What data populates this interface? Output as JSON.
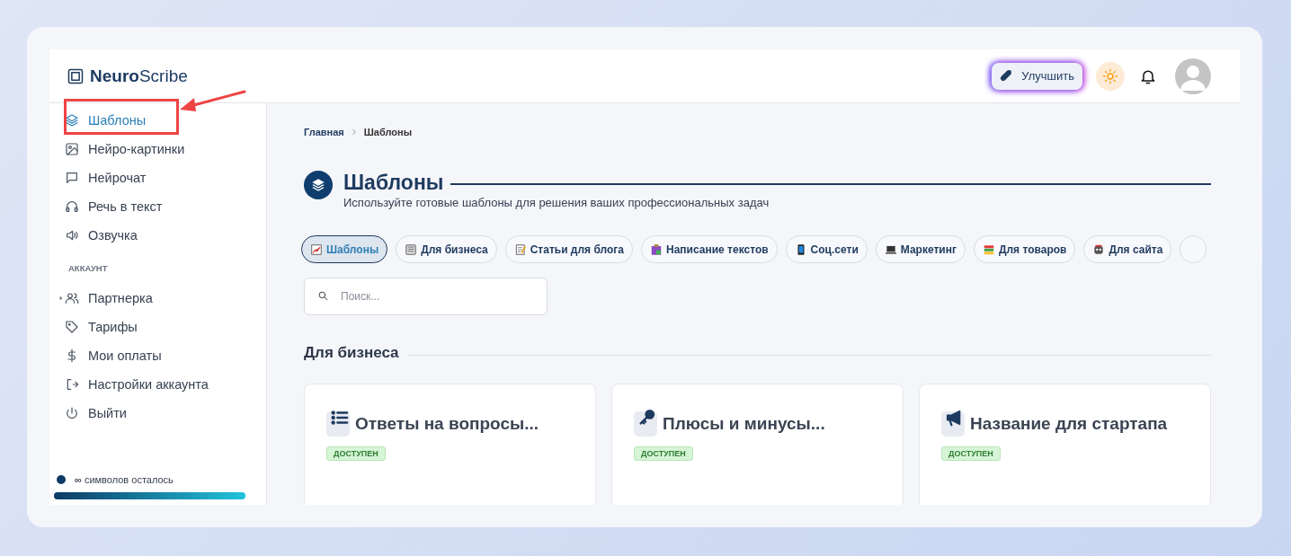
{
  "header": {
    "logo_bold": "Neuro",
    "logo_light": "Scribe",
    "upgrade_button": "Улучшить"
  },
  "sidebar": {
    "items": [
      {
        "label": "Шаблоны",
        "selected": true,
        "has_submenu": false
      },
      {
        "label": "Нейро-картинки",
        "selected": false,
        "has_submenu": false
      },
      {
        "label": "Нейрочат",
        "selected": false,
        "has_submenu": false
      },
      {
        "label": "Речь в текст",
        "selected": false,
        "has_submenu": false
      },
      {
        "label": "Озвучка",
        "selected": false,
        "has_submenu": false
      }
    ],
    "section_title": "АККАУНТ",
    "account_items": [
      {
        "label": "Партнерка",
        "selected": false,
        "has_submenu": true
      },
      {
        "label": "Тарифы",
        "selected": false,
        "has_submenu": false
      },
      {
        "label": "Мои оплаты",
        "selected": false,
        "has_submenu": false
      },
      {
        "label": "Настройки аккаунта",
        "selected": false,
        "has_submenu": false
      },
      {
        "label": "Выйти",
        "selected": false,
        "has_submenu": false
      }
    ],
    "usage": {
      "text": "**∞** символов осталось",
      "level": 1
    }
  },
  "breadcrumb": [
    "Главная",
    "Шаблоны"
  ],
  "page": {
    "title": "Шаблоны",
    "subtitle": "Используйте готовые шаблоны для решения ваших профессиональных задач"
  },
  "categories": [
    {
      "label": "Шаблоны",
      "selected": true
    },
    {
      "label": "Для бизнеса",
      "selected": false
    },
    {
      "label": "Статьи для блога",
      "selected": false
    },
    {
      "label": "Написание текстов",
      "selected": false
    },
    {
      "label": "Соц.сети",
      "selected": false
    },
    {
      "label": "Маркетинг",
      "selected": false
    },
    {
      "label": "Для товаров",
      "selected": false
    },
    {
      "label": "Для сайта",
      "selected": false
    }
  ],
  "search": {
    "placeholder": "Поиск..."
  },
  "section": {
    "title": "Для бизнеса",
    "cards": [
      {
        "title": "Ответы на вопросы...",
        "badge": "ДОСТУПЕН"
      },
      {
        "title": "Плюсы и минусы...",
        "badge": "ДОСТУПЕН"
      },
      {
        "title": "Название для стартапа",
        "badge": "ДОСТУПЕН"
      }
    ]
  },
  "annotations": {
    "highlight_box": true,
    "arrow": true
  }
}
